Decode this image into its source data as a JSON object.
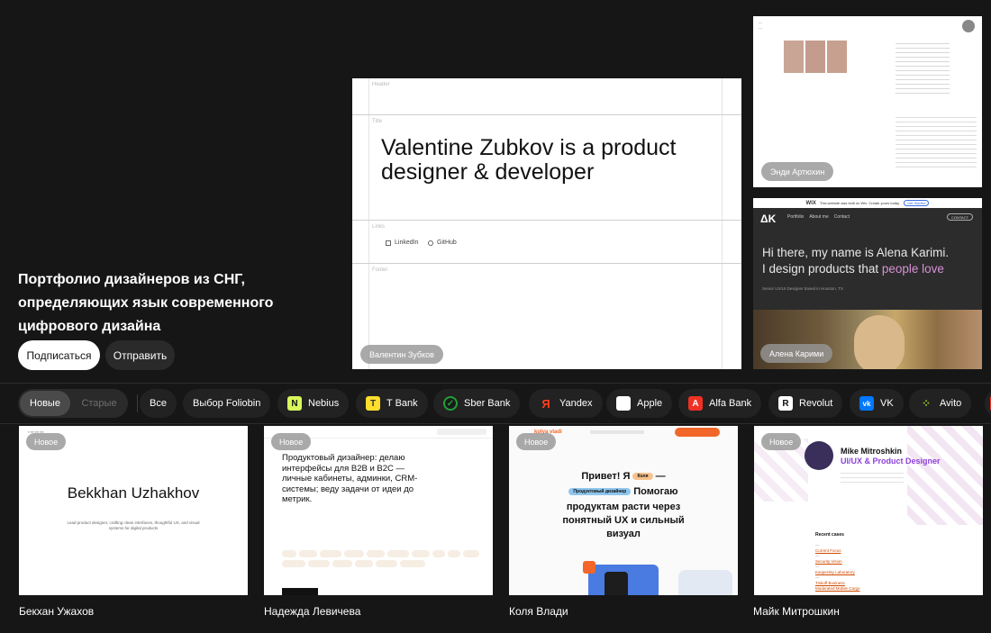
{
  "hero": {
    "headline": "Портфолио дизайнеров из СНГ, определяющих язык современного цифрового дизайна",
    "subscribe_label": "Подписаться",
    "send_label": "Отправить"
  },
  "featured": {
    "main": {
      "name": "Валентин Зубков",
      "title": "Valentine Zubkov is a product designer & developer",
      "header_label": "Header",
      "title_label": "Title",
      "links_label": "Links",
      "footer_label": "Footer",
      "link_linkedin": "LinkedIn",
      "link_github": "GitHub"
    },
    "top": {
      "name": "Энди Артюхин"
    },
    "bottom": {
      "name": "Алена Карими",
      "wix_text": "This website was built on Wix. Create yours today.",
      "wix_btn": "Get Started",
      "nav": [
        "Portfolio",
        "About me",
        "Contact"
      ],
      "contact_btn": "CONTACT",
      "greeting": "Hi there, my name is Alena Karimi.",
      "tagline_pre": "I design products that ",
      "tagline_em": "people love",
      "sub": "Senior UX/UI Designer based in Houston, TX"
    }
  },
  "filters": {
    "sort_new": "Новые",
    "sort_old": "Старые",
    "chips": [
      "Все",
      "Выбор Foliobin",
      "Nebius",
      "T Bank",
      "Sber Bank",
      "Yandex",
      "Apple",
      "Alfa Bank",
      "Revolut",
      "VK",
      "Avito"
    ]
  },
  "cards": [
    {
      "badge": "Новое",
      "name": "Бекхан Ужахов",
      "title": "Bekkhan Uzhakhov",
      "desc": "Lead product designer, crafting clean interfaces, thoughtful UX, and visual systems for digital products"
    },
    {
      "badge": "Новое",
      "name": "Надежда Левичева",
      "title": "Продуктовый дизайнер: делаю интерфейсы для B2B и B2C — личные кабинеты, админки, CRM-системы; веду задачи от идеи до метрик."
    },
    {
      "badge": "Новое",
      "name": "Коля Влади",
      "logo": "kolya vladi",
      "line1": "Привет! Я",
      "tag_inline": "Коля",
      "tag_role": "Продуктовый дизайнер",
      "line2": "Помогаю",
      "line3": "продуктам расти через понятный UX и сильный визуал"
    },
    {
      "badge": "Новое",
      "name": "Майк Митрошкин",
      "title1": "Mike Mitroshkin",
      "title2": "UI/UX & Product Designer",
      "section": "Recent cases",
      "links": [
        "Current Focus",
        "Security Vision",
        "Kaspersky Laboratory",
        "Tinkoff Business",
        "Moderated Mobile Cargo"
      ]
    }
  ]
}
